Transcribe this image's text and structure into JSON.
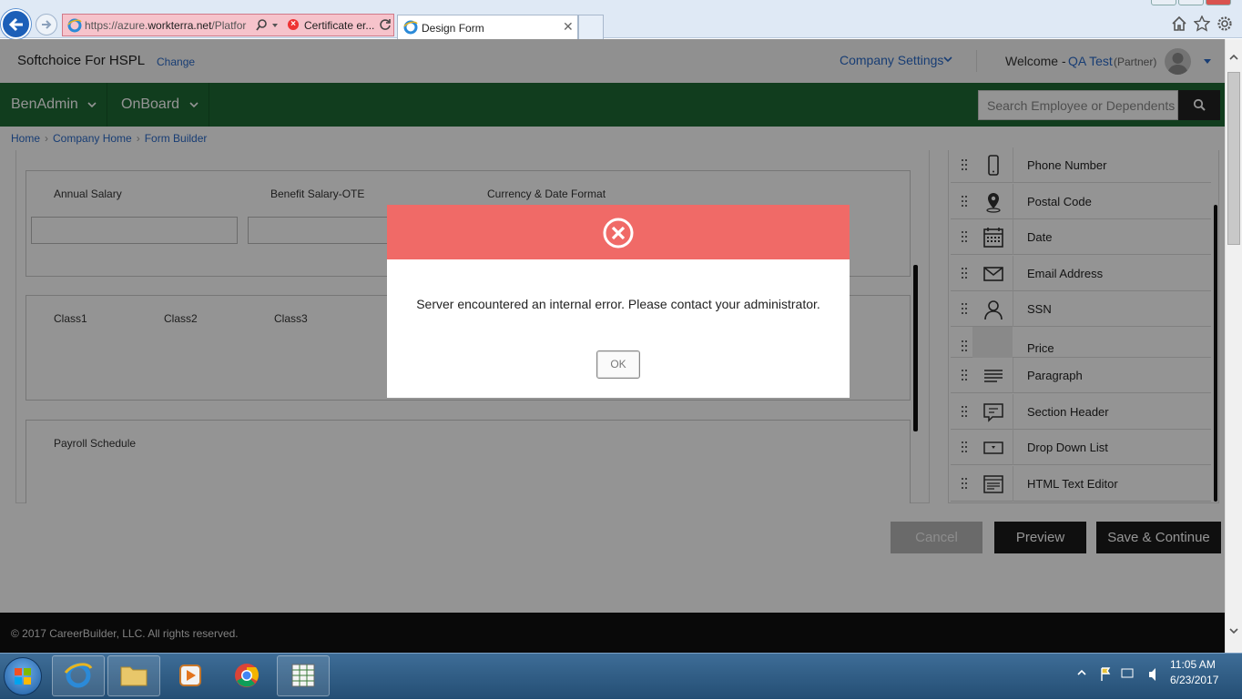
{
  "browser": {
    "address_url_prefix": "https://azure.",
    "address_url_host": "workterra.net",
    "address_url_suffix": "/Platfor",
    "cert_error": "Certificate er...",
    "tab_title": "Design Form"
  },
  "header": {
    "brand": "Softchoice For HSPL",
    "change": "Change",
    "company_settings": "Company Settings",
    "welcome": "Welcome -",
    "username": "QA Test",
    "role": "(Partner)"
  },
  "nav": {
    "items": [
      {
        "label": "BenAdmin"
      },
      {
        "label": "OnBoard"
      }
    ],
    "search_placeholder": "Search Employee or Dependents"
  },
  "breadcrumb": [
    "Home",
    "Company Home",
    "Form Builder"
  ],
  "form": {
    "section1_labels": [
      "Annual Salary",
      "Benefit Salary-OTE",
      "Currency & Date Format"
    ],
    "section2_labels": [
      "Class1",
      "Class2",
      "Class3"
    ],
    "section3_labels": [
      "Payroll Schedule"
    ]
  },
  "field_palette": [
    {
      "label": "Phone Number",
      "icon": "phone-icon"
    },
    {
      "label": "Postal Code",
      "icon": "map-pin-icon"
    },
    {
      "label": "Date",
      "icon": "calendar-icon"
    },
    {
      "label": "Email Address",
      "icon": "envelope-icon"
    },
    {
      "label": "SSN",
      "icon": "person-icon"
    },
    {
      "label": "Price",
      "icon": "price-icon"
    },
    {
      "label": "Paragraph",
      "icon": "paragraph-icon"
    },
    {
      "label": "Section Header",
      "icon": "section-header-icon"
    },
    {
      "label": "Drop Down List",
      "icon": "dropdown-icon"
    },
    {
      "label": "HTML Text Editor",
      "icon": "html-editor-icon"
    }
  ],
  "buttons": {
    "cancel": "Cancel",
    "preview": "Preview",
    "save": "Save & Continue"
  },
  "footer": {
    "copyright": "© 2017 CareerBuilder, LLC. All rights reserved."
  },
  "modal": {
    "message": "Server encountered an internal error. Please contact your administrator.",
    "ok": "OK"
  },
  "taskbar": {
    "time": "11:05 AM",
    "date": "6/23/2017"
  },
  "colors": {
    "nav_green": "#1e6a34",
    "modal_header": "#f06a67",
    "link_blue": "#2a6ac8"
  }
}
